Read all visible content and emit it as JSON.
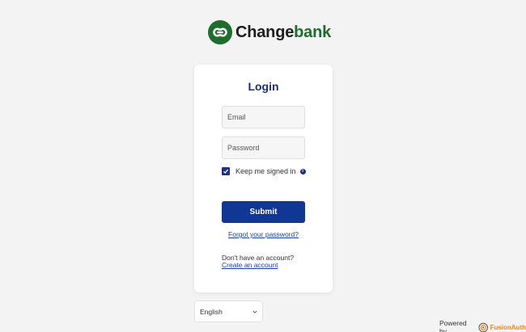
{
  "brand": {
    "name_main": "Change",
    "name_accent": "bank",
    "accent_color": "#1f6d2c"
  },
  "login": {
    "title": "Login",
    "email_placeholder": "Email",
    "password_placeholder": "Password",
    "remember_label": "Keep me signed in",
    "remember_checked": true,
    "submit_label": "Submit",
    "forgot_link": "Forgot your password?",
    "no_account_text": "Don't have an account?",
    "create_link": "Create an account",
    "primary_color": "#0f3793"
  },
  "language": {
    "selected": "English"
  },
  "footer": {
    "powered_by": "Powered by",
    "provider": "FusionAuth"
  },
  "icons": [
    "changebank-logo-icon",
    "info-icon",
    "chevron-down-icon",
    "fusionauth-logo-icon",
    "checkmark-icon"
  ]
}
